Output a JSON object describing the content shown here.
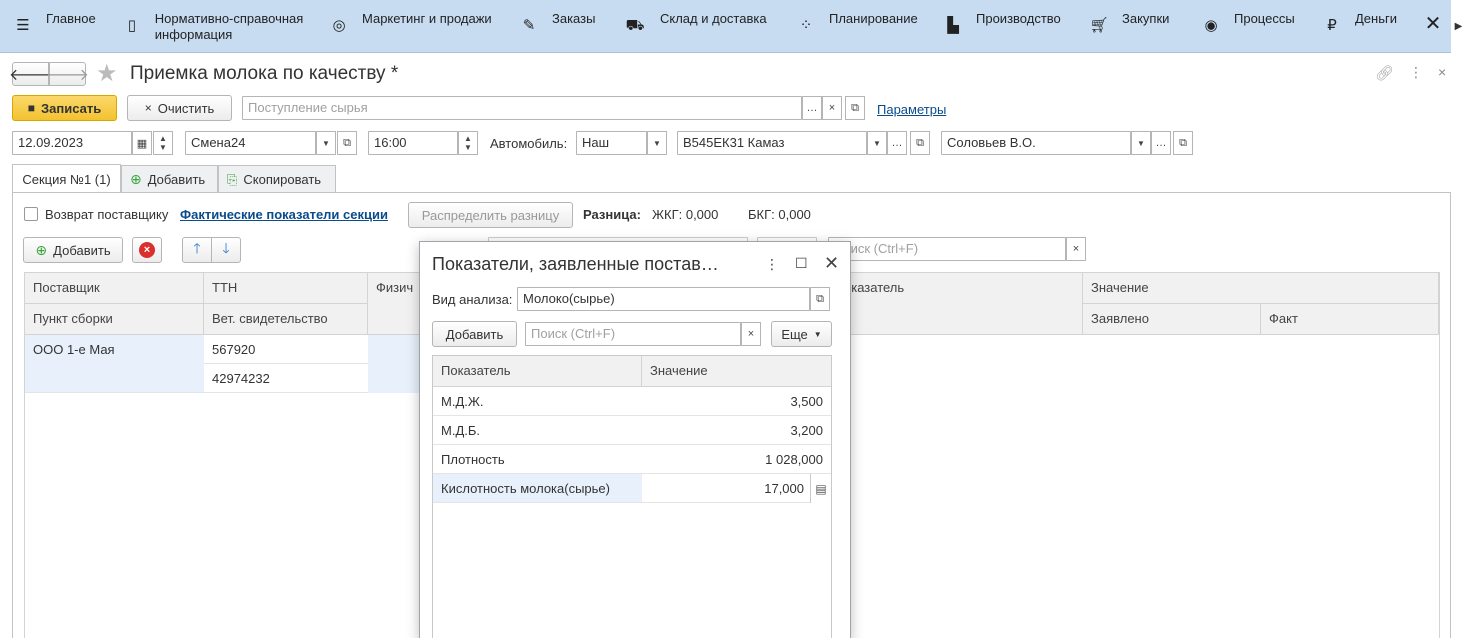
{
  "menu": [
    {
      "label": "Главное",
      "icon": "menu-lines-icon"
    },
    {
      "label": "Нормативно-справочная информация",
      "icon": "book-icon"
    },
    {
      "label": "Маркетинг и продажи",
      "icon": "target-icon"
    },
    {
      "label": "Заказы",
      "icon": "order-icon"
    },
    {
      "label": "Склад и доставка",
      "icon": "truck-icon"
    },
    {
      "label": "Планирование",
      "icon": "planning-icon"
    },
    {
      "label": "Производство",
      "icon": "factory-icon"
    },
    {
      "label": "Закупки",
      "icon": "cart-icon"
    },
    {
      "label": "Процессы",
      "icon": "process-icon"
    },
    {
      "label": "Деньги",
      "icon": "ruble-icon"
    }
  ],
  "window": {
    "title": "Приемка молока по качеству *"
  },
  "toolbar": {
    "save_label": "Записать",
    "clear_label": "Очистить",
    "receipt_placeholder": "Поступление сырья",
    "params_link": "Параметры"
  },
  "header_fields": {
    "date": "12.09.2023",
    "shift": "Смена24",
    "time": "16:00",
    "car_label": "Автомобиль:",
    "car_type": "Наш",
    "car_number": "В545ЕК31 Камаз",
    "driver": "Соловьев В.О."
  },
  "tabs": {
    "section": "Секция №1 (1)",
    "add": "Добавить",
    "copy": "Скопировать"
  },
  "section": {
    "return_label": "Возврат поставщику",
    "actual_link": "Фактические показатели секции",
    "distribute_label": "Распределить разницу",
    "diff_label": "Разница:",
    "zhkg": "ЖКГ: 0,000",
    "bkg": "БКГ: 0,000",
    "add_label": "Добавить",
    "search_placeholder": "Поиск (Ctrl+F)"
  },
  "main_grid": {
    "headers": {
      "supplier": "Поставщик",
      "ttn": "ТТН",
      "phys": "Физич",
      "collection_point": "Пункт сборки",
      "vet": "Вет. свидетельство",
      "indicator": "оказатель",
      "value": "Значение",
      "declared": "Заявлено",
      "fact": "Факт"
    },
    "rows": [
      {
        "supplier": "ООО 1-е Мая",
        "ttn": "567920"
      },
      {
        "supplier": "",
        "ttn": "42974232"
      }
    ]
  },
  "dialog": {
    "title": "Показатели, заявленные постав…",
    "analysis_label": "Вид анализа:",
    "analysis_value": "Молоко(сырье)",
    "add_label": "Добавить",
    "search_placeholder": "Поиск (Ctrl+F)",
    "more_label": "Еще",
    "col_indicator": "Показатель",
    "col_value": "Значение",
    "rows": [
      {
        "name": "М.Д.Ж.",
        "value": "3,500"
      },
      {
        "name": "М.Д.Б.",
        "value": "3,200"
      },
      {
        "name": "Плотность",
        "value": "1 028,000"
      },
      {
        "name": "Кислотность молока(сырье)",
        "value": "17,000"
      }
    ]
  }
}
